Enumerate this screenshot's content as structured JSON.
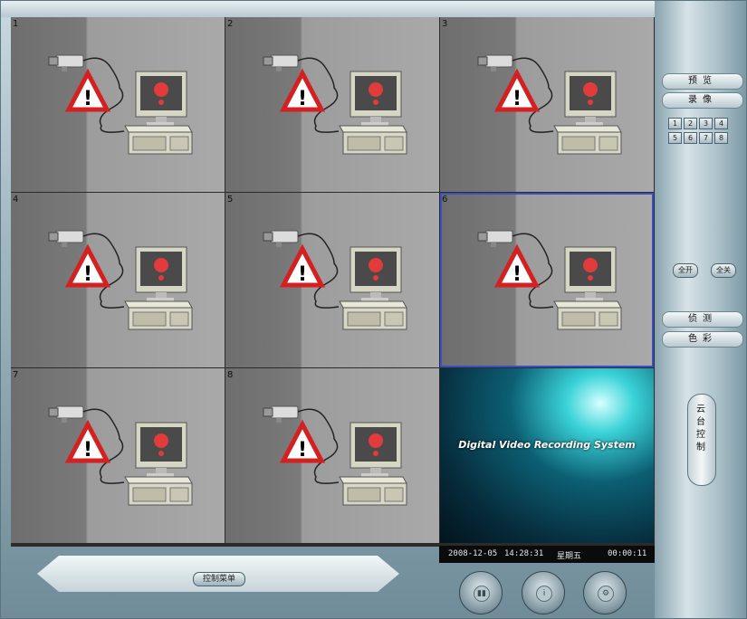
{
  "grid": {
    "cells": [
      {
        "number": "1"
      },
      {
        "number": "2"
      },
      {
        "number": "3"
      },
      {
        "number": "4"
      },
      {
        "number": "5"
      },
      {
        "number": "6",
        "selected": true
      },
      {
        "number": "7"
      },
      {
        "number": "8"
      }
    ],
    "splash_title": "Digital Video Recording System"
  },
  "status": {
    "date": "2008-12-05",
    "time": "14:28:31",
    "weekday": "星期五",
    "elapsed": "00:00:11"
  },
  "right_panel": {
    "preview_label": "预览",
    "record_label": "录像",
    "channels": [
      "1",
      "2",
      "3",
      "4",
      "5",
      "6",
      "7",
      "8"
    ],
    "all_on_label": "全开",
    "all_off_label": "全关",
    "detect_label": "侦测",
    "color_label": "色彩",
    "ptz_label": "云台控制"
  },
  "bottom": {
    "menu_label": "控制菜单",
    "round_buttons": [
      "playback-icon",
      "info-icon",
      "settings-icon"
    ]
  },
  "colors": {
    "selected_outline": "#3b4fc2",
    "warning_red": "#d42020",
    "panel": "#a7bec6"
  }
}
